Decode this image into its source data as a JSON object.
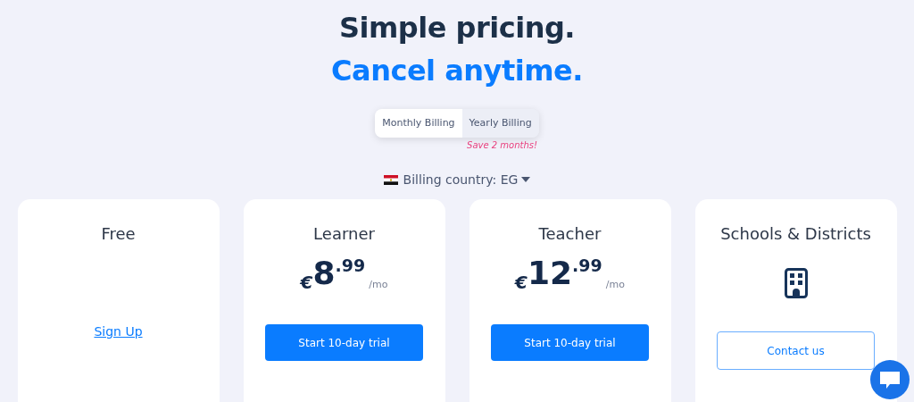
{
  "headline": {
    "line_1": "Simple pricing.",
    "line_2": "Cancel anytime."
  },
  "billing_toggle": [
    {
      "label": "Monthly Billing",
      "selected": true
    },
    {
      "label": "Yearly Billing",
      "selected": false
    }
  ],
  "savings_note": "Save 2 months!",
  "billing_country": {
    "label": "Billing country: EG"
  },
  "plans": [
    {
      "kind": "link",
      "name": "Free",
      "action": "Sign Up"
    },
    {
      "kind": "price",
      "name": "Learner",
      "currency": "€",
      "whole": "8",
      "cents": ".99",
      "period": "/mo",
      "action": "Start 10-day trial"
    },
    {
      "kind": "price",
      "name": "Teacher",
      "currency": "€",
      "whole": "12",
      "cents": ".99",
      "period": "/mo",
      "action": "Start 10-day trial"
    },
    {
      "kind": "contact",
      "name": "Schools & Districts",
      "action": "Contact us"
    }
  ]
}
